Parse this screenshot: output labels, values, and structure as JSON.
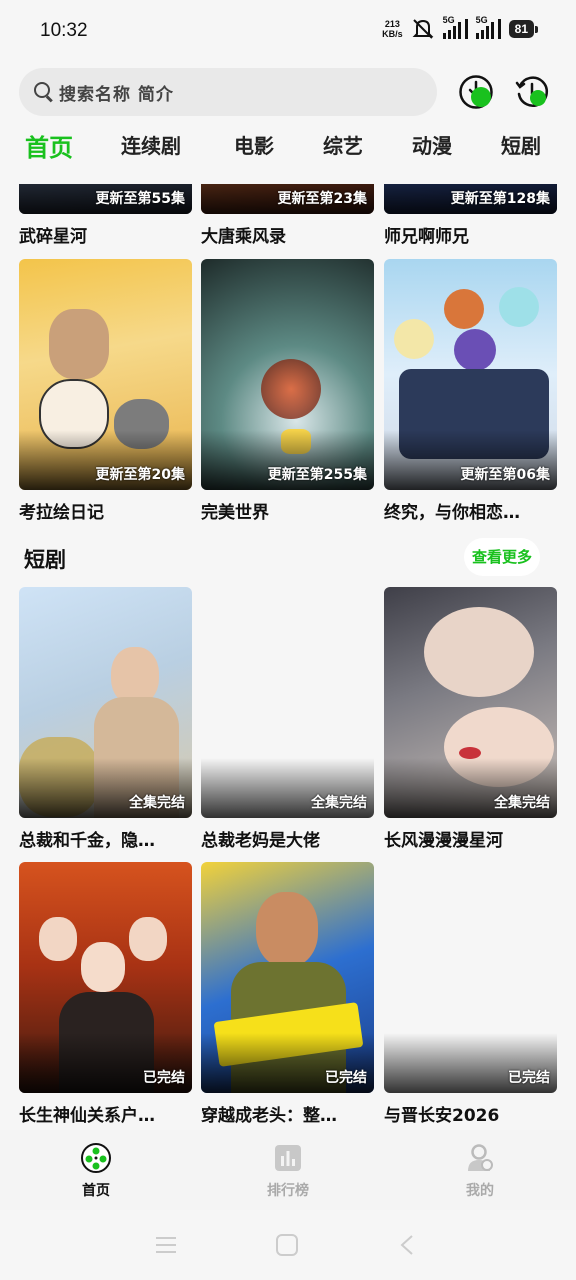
{
  "status": {
    "time": "10:32",
    "net_speed_value": "213",
    "net_speed_unit": "KB/s",
    "sim1": "5G",
    "sim2": "5G",
    "battery": "81"
  },
  "search": {
    "placeholder": "搜索名称 简介"
  },
  "tabs": [
    {
      "label": "首页",
      "active": true
    },
    {
      "label": "连续剧"
    },
    {
      "label": "电影"
    },
    {
      "label": "综艺"
    },
    {
      "label": "动漫"
    },
    {
      "label": "短剧"
    }
  ],
  "anime_rows": [
    [
      {
        "title": "武碎星河",
        "badge": "更新至第55集"
      },
      {
        "title": "大唐乘风录",
        "badge": "更新至第23集"
      },
      {
        "title": "师兄啊师兄",
        "badge": "更新至第128集"
      }
    ],
    [
      {
        "title": "考拉绘日记",
        "badge": "更新至第20集"
      },
      {
        "title": "完美世界",
        "badge": "更新至第255集"
      },
      {
        "title": "终究，与你相恋…",
        "badge": "更新至第06集"
      }
    ]
  ],
  "short_section": {
    "heading": "短剧",
    "more": "查看更多"
  },
  "short_rows": [
    [
      {
        "title": "总裁和千金，隐…",
        "badge": "全集完结"
      },
      {
        "title": "总裁老妈是大佬",
        "badge": "全集完结"
      },
      {
        "title": "长风漫漫漫星河",
        "badge": "全集完结"
      }
    ],
    [
      {
        "title": "长生神仙关系户…",
        "badge": "已完结"
      },
      {
        "title": "穿越成老头：整…",
        "badge": "已完结"
      },
      {
        "title": "与晋长安2026",
        "badge": "已完结"
      }
    ]
  ],
  "bottom_nav": [
    {
      "label": "首页",
      "icon": "film-reel-icon",
      "active": true
    },
    {
      "label": "排行榜",
      "icon": "chart-icon"
    },
    {
      "label": "我的",
      "icon": "profile-icon"
    }
  ],
  "colors": {
    "accent": "#19c11e",
    "background": "#f6f6f6"
  }
}
